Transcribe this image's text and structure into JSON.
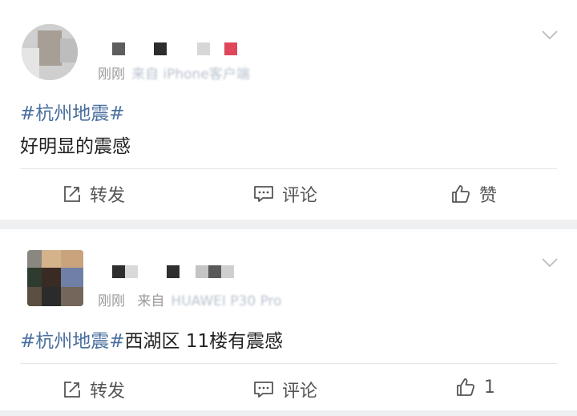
{
  "posts": [
    {
      "username_masked": "■ ■ ■ ■",
      "meta_time": "刚刚",
      "meta_source": "来自 iPhone客户端",
      "hashtag": "#杭州地震#",
      "body": "",
      "body_line2": "好明显的震感",
      "actions": {
        "repost": "转发",
        "comment": "评论",
        "like": "赞"
      }
    },
    {
      "username_masked": "■ ■ ■ ■",
      "meta_time": "刚刚",
      "meta_source_prefix": "来自",
      "meta_source": "HUAWEI P30 Pro",
      "hashtag": "#杭州地震#",
      "body": "西湖区 11楼有震感",
      "actions": {
        "repost": "转发",
        "comment": "评论",
        "like": "1"
      }
    }
  ],
  "colors": {
    "hashtag": "#4a6f9e",
    "text": "#222222",
    "meta": "#9a9a9a",
    "background": "#eef0f2",
    "card": "#ffffff",
    "red_pixel": "#e0475a"
  },
  "icons": [
    "repost-icon",
    "comment-icon",
    "like-icon",
    "chevron-down-icon"
  ]
}
